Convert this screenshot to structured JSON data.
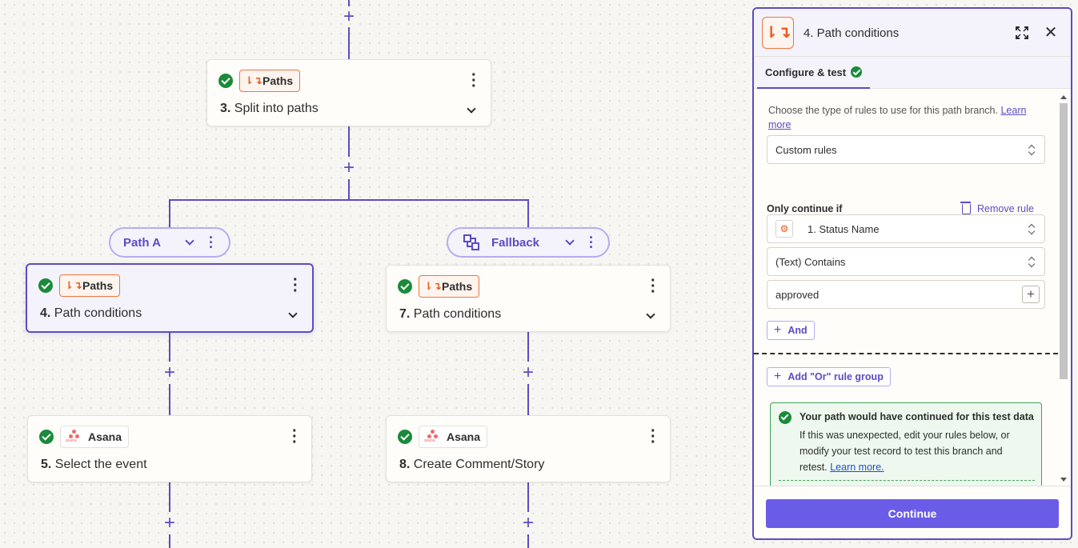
{
  "canvas": {
    "steps": [
      {
        "app": "Paths",
        "number": "3.",
        "title": "Split into paths"
      },
      {
        "app": "Paths",
        "number": "4.",
        "title": "Path conditions"
      },
      {
        "app": "Paths",
        "number": "7.",
        "title": "Path conditions"
      },
      {
        "app": "Asana",
        "number": "5.",
        "title": "Select the event"
      },
      {
        "app": "Asana",
        "number": "8.",
        "title": "Create Comment/Story"
      }
    ],
    "paths": [
      {
        "label": "Path A"
      },
      {
        "label": "Fallback"
      }
    ],
    "asana_wordmark": "asana"
  },
  "panel": {
    "title": "4. Path conditions",
    "tab": "Configure & test",
    "help_text": "Choose the type of rules to use for this path branch.",
    "help_link": "Learn more",
    "rule_type": "Custom rules",
    "only_continue_if": "Only continue if",
    "remove_rule": "Remove rule",
    "field": "1. Status Name",
    "operator": "(Text) Contains",
    "value": "approved",
    "and_button": "And",
    "or_button": "Add \"Or\" rule group",
    "success_title": "Your path would have continued for this test data",
    "success_body": "If this was unexpected, edit your rules below, or modify your test record to test this branch and retest.",
    "success_link": "Learn more.",
    "continue_button": "Continue"
  },
  "colors": {
    "accent": "#5b4bc4",
    "button": "#6b5ce7",
    "paths_orange": "#e85a1e",
    "success_green": "#1b8a3a"
  }
}
